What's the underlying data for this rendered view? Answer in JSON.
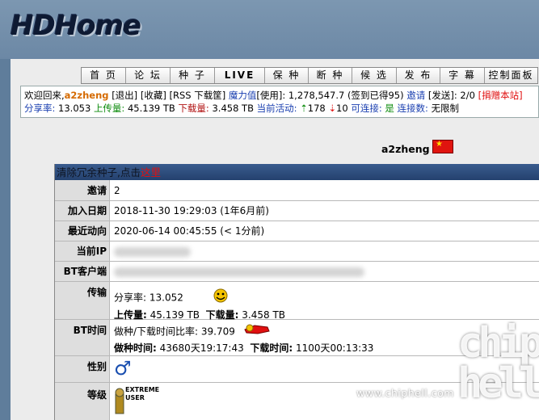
{
  "header": {
    "logo_text": "HDHome"
  },
  "nav": {
    "tabs": [
      {
        "label": "首 页",
        "w": 55
      },
      {
        "label": "论 坛",
        "w": 55
      },
      {
        "label": "种 子",
        "w": 55
      },
      {
        "label": "LIVE",
        "w": 62,
        "bold": true
      },
      {
        "label": "保 种",
        "w": 54
      },
      {
        "label": "断 种",
        "w": 54
      },
      {
        "label": "候 选",
        "w": 55
      },
      {
        "label": "发 布",
        "w": 54
      },
      {
        "label": "字 幕",
        "w": 55
      },
      {
        "label": "控制面板",
        "w": 65
      }
    ]
  },
  "info": {
    "welcome": "欢迎回来,",
    "username": "a2zheng",
    "logout": "[退出]",
    "favorites": "[收藏]",
    "rss": "[RSS 下载筐]",
    "bonus_label": "魔力值",
    "bonus_rest": "[使用]: 1,278,547.7 (签到已得95)",
    "invite_label": "邀请",
    "invite_rest": "[发送]: 2/0",
    "donate": "[捐赠本站]",
    "ratio_label": "分享率:",
    "ratio_value": "13.053",
    "upload_label": "上传量:",
    "upload_value": "45.139 TB",
    "download_label": "下载量:",
    "download_value": "3.458 TB",
    "active_label": "当前活动:",
    "seeding_count": "178",
    "leeching_count": "10",
    "connectable_label": "可连接:",
    "connectable_value": "是",
    "connections_label": "连接数:",
    "connections_value": "无限制"
  },
  "profile": {
    "username": "a2zheng",
    "flag": "china-flag",
    "notice_text": "清除冗余种子,点击",
    "notice_link": "这里",
    "rows": {
      "invites_label": "邀请",
      "invites_value": "2",
      "joined_label": "加入日期",
      "joined_value": "2018-11-30 19:29:03 (1年6月前)",
      "last_action_label": "最近动向",
      "last_action_value": "2020-06-14 00:45:55 (< 1分前)",
      "ip_label": "当前IP",
      "client_label": "BT客户端",
      "transfer_label": "传输",
      "transfer_ratio": "分享率: 13.052",
      "transfer_upload_label": "上传量:",
      "transfer_upload_value": "45.139 TB",
      "transfer_download_label": "下载量:",
      "transfer_download_value": "3.458 TB",
      "bttime_label": "BT时间",
      "bttime_ratio": "做种/下载时间比率: 39.709",
      "seed_time_label": "做种时间:",
      "seed_time_value": "43680天19:17:43",
      "dl_time_label": "下载时间:",
      "dl_time_value": "1100天00:13:33",
      "gender_label": "性别",
      "gender_icon": "male-icon",
      "class_label": "等级",
      "class_badge": "EXTREME USER"
    }
  },
  "watermark": {
    "url": "www.chiphell.com",
    "logo": "chip hell"
  },
  "colors": {
    "nav_bg": "#ffffff",
    "header_blue": "#2b4a7a",
    "label_bg": "#dedede"
  }
}
